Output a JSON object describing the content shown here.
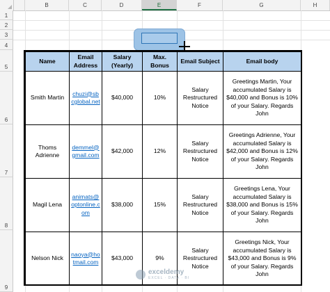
{
  "columns": [
    "B",
    "C",
    "D",
    "E",
    "F",
    "G",
    "H"
  ],
  "selected_column": "E",
  "rows": [
    "1",
    "2",
    "3",
    "4",
    "5",
    "6",
    "7",
    "8",
    "9"
  ],
  "table": {
    "headers": [
      "Name",
      "Email Address",
      "Salary (Yearly)",
      "Max. Bonus",
      "Email Subject",
      "Email body"
    ],
    "records": [
      {
        "name": "Smith Martin",
        "email": "chuzi@sbcglobal.net",
        "salary": "$40,000",
        "bonus": "10%",
        "subject": "Salary Restructured Notice",
        "body": "Greetings Martin, Your accumulated Salary is $40,000 and Bonus is 10% of your Salary. Regards John"
      },
      {
        "name": "Thoms Adrienne",
        "email": "demmel@gmail.com",
        "salary": "$42,000",
        "bonus": "12%",
        "subject": "Salary Restructured Notice",
        "body": "Greetings Adrienne, Your accumulated Salary is $42,000 and Bonus is 12% of your Salary. Regards John"
      },
      {
        "name": "Magil Lena",
        "email": "animats@optonline.com",
        "salary": "$38,000",
        "bonus": "15%",
        "subject": "Salary Restructured Notice",
        "body": "Greetings Lena, Your accumulated Salary is $38,000 and Bonus is 15% of your Salary. Regards John"
      },
      {
        "name": "Nelson  Nick",
        "email": "naoya@hotmail.com",
        "salary": "$43,000",
        "bonus": "9%",
        "subject": "Salary Restructured Notice",
        "body": "Greetings Nick, Your accumulated Salary is $43,000 and Bonus is 9% of your Salary. Regards John"
      }
    ]
  },
  "watermark": {
    "brand": "exceldemy",
    "tagline": "EXCEL · DATA · BI"
  },
  "colors": {
    "header_fill": "#b8d3ee",
    "shape_fill": "#9dc3e6",
    "link": "#0563c1"
  }
}
